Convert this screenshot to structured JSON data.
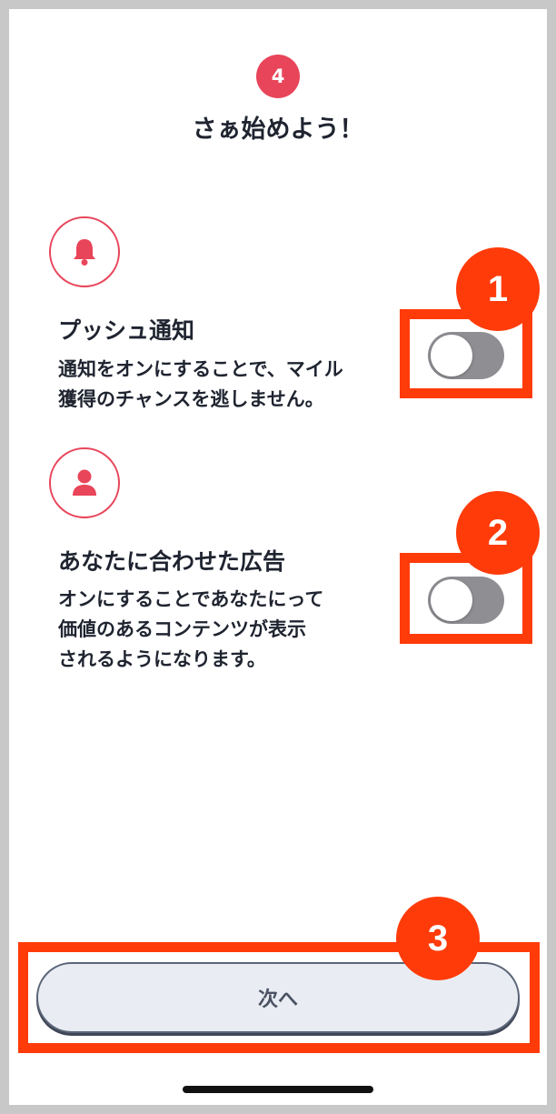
{
  "header": {
    "step_number": "4",
    "title": "さぁ始めよう！"
  },
  "settings": [
    {
      "icon": "bell-icon",
      "title": "プッシュ通知",
      "description": "通知をオンにすることで、マイル\n獲得のチャンスを逃しません。",
      "toggle_on": false
    },
    {
      "icon": "person-icon",
      "title": "あなたに合わせた広告",
      "description": "オンにすることであなたにって\n価値のあるコンテンツが表示\nされるようになります。",
      "toggle_on": false
    }
  ],
  "footer": {
    "next_label": "次へ"
  },
  "callouts": [
    "1",
    "2",
    "3"
  ],
  "colors": {
    "accent": "#e8455a",
    "annotation": "#ff3b0a",
    "toggle_off": "#8e8e93",
    "text": "#1f2430"
  }
}
